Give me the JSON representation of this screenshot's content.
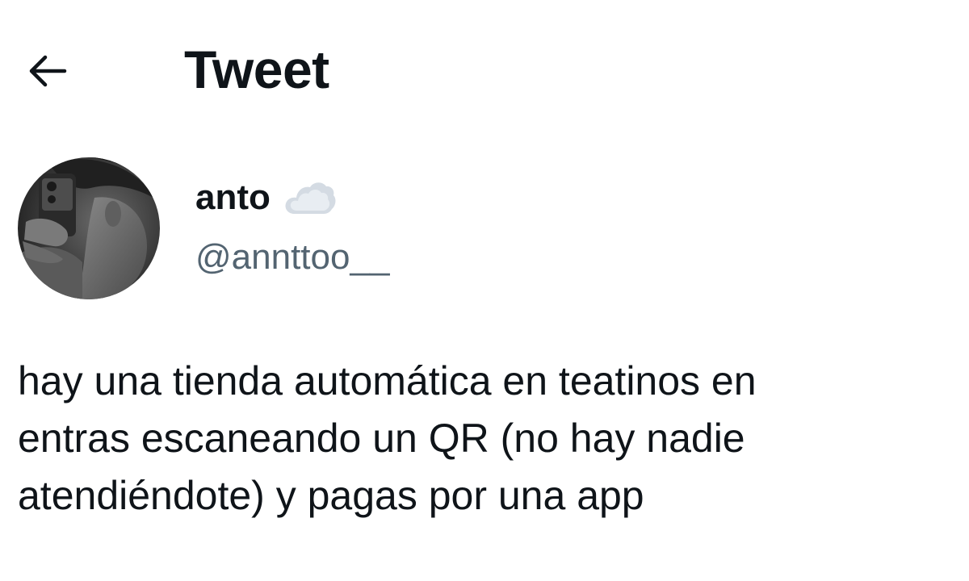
{
  "header": {
    "back_icon": "arrow-left-icon",
    "title": "Tweet"
  },
  "author": {
    "avatar_icon": "user-avatar",
    "display_name": "anto",
    "status_emoji": "cloud-icon",
    "handle": "@annttoo__"
  },
  "tweet": {
    "lines": [
      "hay una tienda automática en teatinos en",
      "entras escaneando un QR (no hay nadie",
      "atendiéndote) y pagas por una app"
    ]
  },
  "colors": {
    "text_primary": "#0f1419",
    "text_secondary": "#536471",
    "background": "#ffffff"
  }
}
